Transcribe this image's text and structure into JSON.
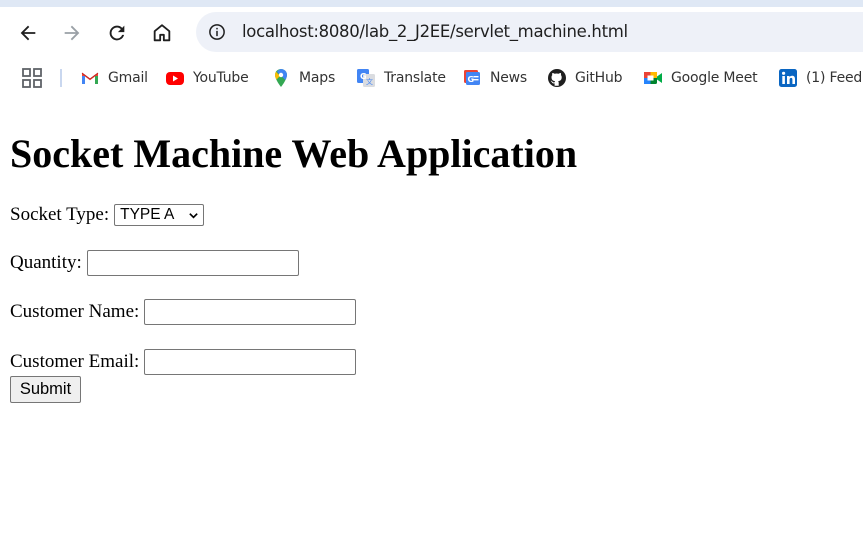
{
  "browser": {
    "nav": {
      "back_icon": "arrow-left-icon",
      "forward_icon": "arrow-right-icon",
      "reload_icon": "reload-icon",
      "home_icon": "home-icon"
    },
    "omnibox": {
      "site_info_icon": "info-icon",
      "url": "localhost:8080/lab_2_J2EE/servlet_machine.html"
    },
    "bookmarks": [
      {
        "label": "Gmail",
        "icon": "gmail-icon"
      },
      {
        "label": "YouTube",
        "icon": "youtube-icon"
      },
      {
        "label": "Maps",
        "icon": "maps-icon"
      },
      {
        "label": "Translate",
        "icon": "translate-icon"
      },
      {
        "label": "News",
        "icon": "news-icon"
      },
      {
        "label": "GitHub",
        "icon": "github-icon"
      },
      {
        "label": "Google Meet",
        "icon": "meet-icon"
      },
      {
        "label": "(1) Feed",
        "icon": "linkedin-icon"
      }
    ],
    "colors": {
      "chrome_top": "#dfe8f5",
      "omnibox_bg": "#eef1f8",
      "youtube_red": "#ff0000",
      "linkedin_blue": "#0a66c2"
    }
  },
  "page": {
    "title": "Socket Machine Web Application",
    "socket_type": {
      "label": "Socket Type:",
      "selected": "TYPE A"
    },
    "quantity": {
      "label": "Quantity:",
      "value": ""
    },
    "customer_name": {
      "label": "Customer Name:",
      "value": ""
    },
    "customer_email": {
      "label": "Customer Email:",
      "value": ""
    },
    "submit_label": "Submit"
  }
}
